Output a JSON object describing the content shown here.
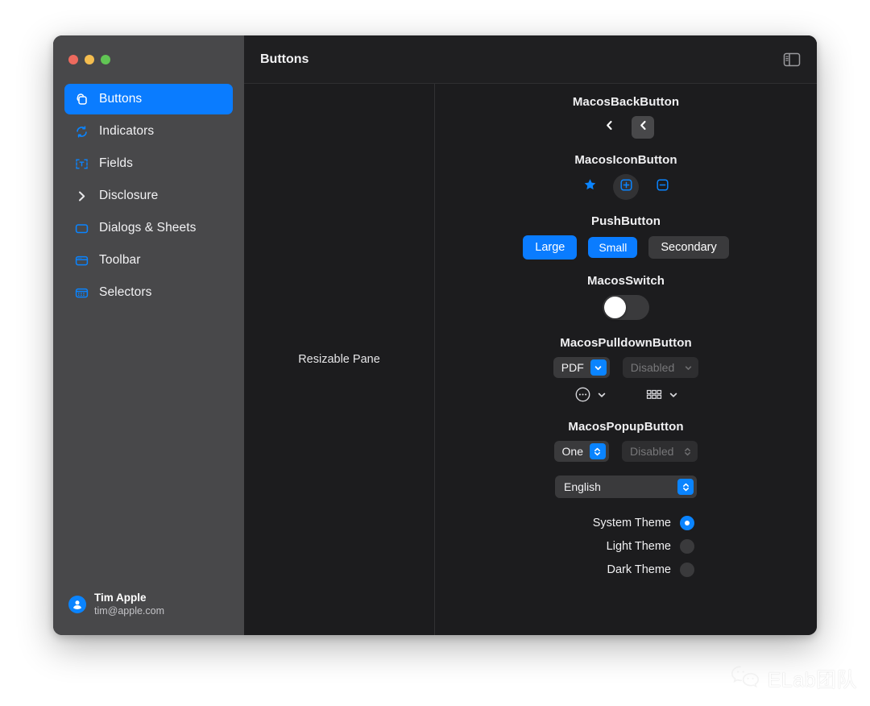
{
  "window": {
    "traffic_lights": [
      {
        "name": "close",
        "color": "#ed6a5e"
      },
      {
        "name": "minimize",
        "color": "#f4bd4f"
      },
      {
        "name": "zoom",
        "color": "#61c554"
      }
    ]
  },
  "sidebar": {
    "items": [
      {
        "label": "Buttons",
        "icon": "stacked-squares-icon",
        "selected": true
      },
      {
        "label": "Indicators",
        "icon": "refresh-circle-icon",
        "selected": false
      },
      {
        "label": "Fields",
        "icon": "text-field-icon",
        "selected": false
      },
      {
        "label": "Disclosure",
        "icon": "chevron-right-icon",
        "selected": false
      },
      {
        "label": "Dialogs & Sheets",
        "icon": "rounded-rect-icon",
        "selected": false
      },
      {
        "label": "Toolbar",
        "icon": "toolbar-window-icon",
        "selected": false
      },
      {
        "label": "Selectors",
        "icon": "calendar-grid-icon",
        "selected": false
      }
    ],
    "user": {
      "name": "Tim Apple",
      "email": "tim@apple.com",
      "avatar_icon": "person-circle-icon"
    },
    "accent_color": "#0a7cff",
    "background_color": "#48484a"
  },
  "toolbar": {
    "title": "Buttons",
    "sidebar_toggle_icon": "sidebar-toggle-icon"
  },
  "resizable_pane": {
    "label": "Resizable Pane"
  },
  "content": {
    "sections": [
      {
        "title": "MacosBackButton",
        "buttons": [
          {
            "icon": "chevron-left-icon",
            "style": "plain"
          },
          {
            "icon": "chevron-left-icon",
            "style": "filled"
          }
        ]
      },
      {
        "title": "MacosIconButton",
        "buttons": [
          {
            "icon": "star-icon",
            "style": "plain"
          },
          {
            "icon": "plus-box-icon",
            "style": "hovered"
          },
          {
            "icon": "minus-box-icon",
            "style": "plain"
          }
        ]
      },
      {
        "title": "PushButton",
        "buttons": [
          {
            "label": "Large",
            "style": "primary-large"
          },
          {
            "label": "Small",
            "style": "primary-small"
          },
          {
            "label": "Secondary",
            "style": "secondary"
          }
        ]
      },
      {
        "title": "MacosSwitch",
        "switch": {
          "state": "off",
          "knob_color": "#ffffff",
          "track_color": "#3a3a3c"
        }
      },
      {
        "title": "MacosPulldownButton",
        "row1": [
          {
            "label": "PDF",
            "disabled": false,
            "chevron": "chevron-down-icon"
          },
          {
            "label": "Disabled",
            "disabled": true,
            "chevron": "chevron-down-icon"
          }
        ],
        "row2": [
          {
            "icon": "ellipsis-circle-icon",
            "chevron": "chevron-down-icon"
          },
          {
            "icon": "grid-squares-icon",
            "chevron": "chevron-down-icon"
          }
        ]
      },
      {
        "title": "MacosPopupButton",
        "row1": [
          {
            "label": "One",
            "disabled": false,
            "chevron": "chevron-up-down-icon"
          },
          {
            "label": "Disabled",
            "disabled": true,
            "chevron": "chevron-up-down-icon"
          }
        ],
        "wide": {
          "label": "English",
          "chevron": "chevron-up-down-icon"
        }
      }
    ],
    "theme_options": [
      {
        "label": "System Theme",
        "selected": true
      },
      {
        "label": "Light Theme",
        "selected": false
      },
      {
        "label": "Dark Theme",
        "selected": false
      }
    ]
  },
  "watermark": {
    "text": "ELab团队",
    "icon": "wechat-bubbles-icon"
  }
}
